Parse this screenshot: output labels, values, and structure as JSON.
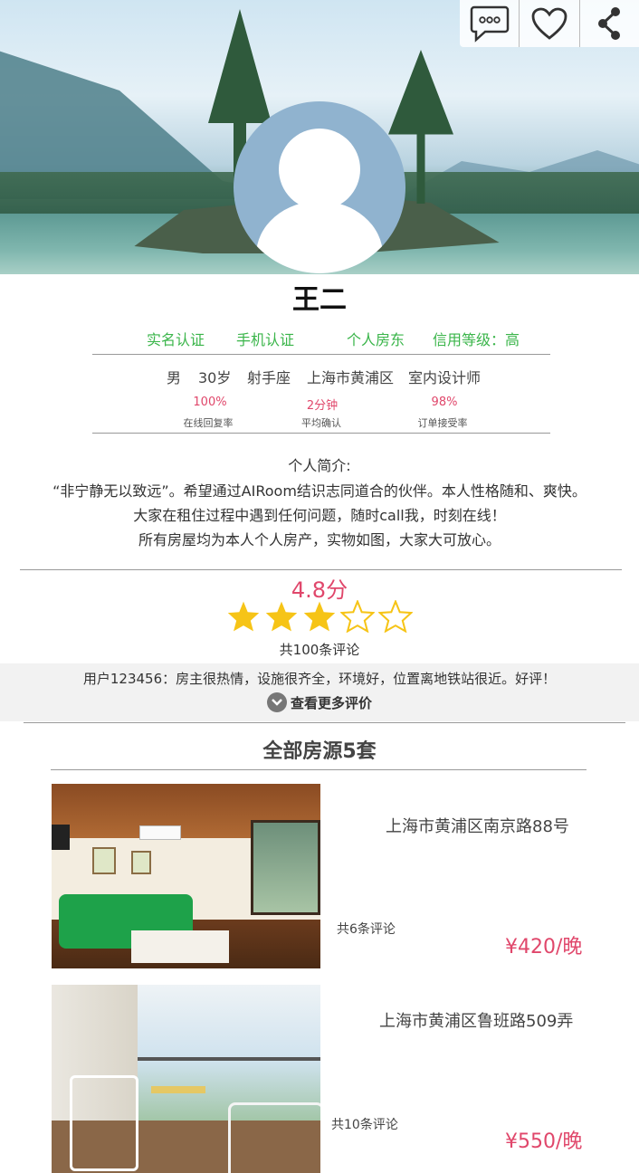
{
  "header": {
    "actions": [
      {
        "icon": "chat-bubble-icon",
        "label": ""
      },
      {
        "icon": "heart-icon",
        "label": ""
      },
      {
        "icon": "share-icon",
        "label": ""
      }
    ]
  },
  "profile": {
    "name": "王二",
    "certifications": [
      "实名认证",
      "手机认证",
      "个人房东",
      "信用等级：高"
    ],
    "info": [
      "男",
      "30岁",
      "射手座",
      "上海市黄浦区",
      "室内设计师"
    ],
    "stats": [
      {
        "value": "100%",
        "label": "在线回复率"
      },
      {
        "value": "2分钟",
        "label": "平均确认"
      },
      {
        "value": "98%",
        "label": "订单接受率"
      }
    ],
    "intro_title": "个人简介:",
    "intro_lines": [
      "“非宁静无以致远”。希望通过AIRoom结识志同道合的伙伴。本人性格随和、爽快。",
      "大家在租住过程中遇到任何问题，随时call我，时刻在线！",
      "所有房屋均为本人个人房产，实物如图，大家大可放心。"
    ]
  },
  "rating": {
    "score_text": "4.8分",
    "stars_filled": 3,
    "stars_total": 5,
    "review_count": "共100条评论",
    "sample_review": "用户123456：房主很热情，设施很齐全，环境好，位置离地铁站很近。好评！",
    "more_label": "查看更多评价"
  },
  "listings": {
    "title": "全部房源5套",
    "items": [
      {
        "address": "上海市黄浦区南京路88号",
        "reviews": "共6条评论",
        "price": "¥420/晚"
      },
      {
        "address": "上海市黄浦区鲁班路509弄",
        "reviews": "共10条评论",
        "price": "¥550/晚"
      }
    ]
  },
  "colors": {
    "green": "#3ab54a",
    "accent": "#e0476b",
    "star": "#f6c417"
  }
}
